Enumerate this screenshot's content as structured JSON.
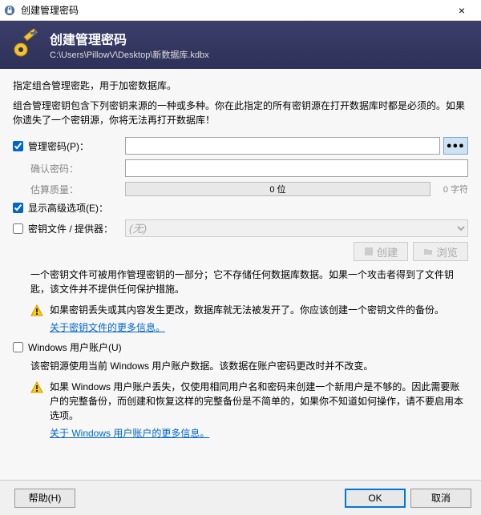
{
  "window": {
    "title": "创建管理密码"
  },
  "header": {
    "title": "创建管理密码",
    "path": "C:\\Users\\PillowV\\Desktop\\新数据库.kdbx"
  },
  "intro": {
    "line1": "指定组合管理密匙，用于加密数据库。",
    "line2": "组合管理密钥包含下列密钥来源的一种或多种。你在此指定的所有密钥源在打开数据库时都是必须的。如果你遗失了一个密钥源，你将无法再打开数据库！"
  },
  "password": {
    "label": "管理密码(P)：",
    "confirm_label": "确认密码：",
    "quality_label": "估算质量：",
    "quality_bits": "0 位",
    "quality_chars": "0 字符",
    "dots": "●●●"
  },
  "advanced": {
    "label": "显示高级选项(E)："
  },
  "keyfile": {
    "label": "密钥文件 / 提供器：",
    "select_value": "(无)",
    "create_btn": "创建",
    "browse_btn": "浏览",
    "desc": "一个密钥文件可被用作管理密钥的一部分；它不存储任何数据库数据。如果一个攻击者得到了文件钥匙，该文件并不提供任何保护措施。",
    "warning": "如果密钥丢失或其内容发生更改，数据库就无法被发开了。你应该创建一个密钥文件的备份。",
    "link": "关于密钥文件的更多信息。"
  },
  "winaccount": {
    "label": "Windows 用户账户(U)",
    "desc": "该密钥源使用当前 Windows 用户账户数据。该数据在账户密码更改时并不改变。",
    "warning": "如果 Windows 用户账户丢失，仅使用相同用户名和密码来创建一个新用户是不够的。因此需要账户的完整备份，而创建和恢复这样的完整备份是不简单的，如果你不知道如何操作，请不要启用本选项。",
    "link": "关于 Windows 用户账户的更多信息。"
  },
  "footer": {
    "help": "帮助(H)",
    "ok": "OK",
    "cancel": "取消"
  }
}
